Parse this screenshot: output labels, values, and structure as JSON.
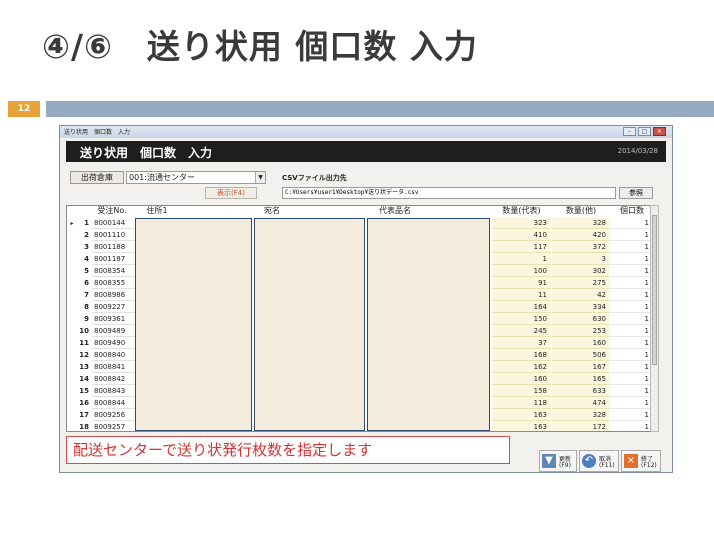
{
  "slide": {
    "title": "④/⑥　送り状用 個口数 入力",
    "page_number": "12",
    "accent_color": "#e8a23a",
    "bar_color": "#96abc2"
  },
  "window": {
    "caption": "送り状用　個口数　入力",
    "min": "–",
    "max": "□",
    "close": "×"
  },
  "app": {
    "title": "送り状用　個口数　入力",
    "date": "2014/03/28"
  },
  "form": {
    "warehouse_label": "出荷倉庫",
    "warehouse_value": "001:流通センター",
    "show_button": "表示(F4)",
    "csv_label": "CSVファイル出力先",
    "csv_path": "C:¥Users¥user1¥Desktop¥送り状データ.csv",
    "ref_button": "参照"
  },
  "grid": {
    "headers": {
      "order": "受注No.",
      "address": "住所1",
      "recipient": "宛名",
      "item": "代表品名",
      "qty_rep": "数量(代表)",
      "qty_other": "数量(他)",
      "count": "個口数"
    },
    "rows": [
      {
        "no": "1",
        "order": "8000144",
        "qty_rep": "323",
        "qty_other": "328",
        "count": "1",
        "current": "▸"
      },
      {
        "no": "2",
        "order": "8001110",
        "qty_rep": "410",
        "qty_other": "420",
        "count": "1"
      },
      {
        "no": "3",
        "order": "8001188",
        "qty_rep": "117",
        "qty_other": "372",
        "count": "1"
      },
      {
        "no": "4",
        "order": "8001187",
        "qty_rep": "1",
        "qty_other": "3",
        "count": "1"
      },
      {
        "no": "5",
        "order": "8008354",
        "qty_rep": "100",
        "qty_other": "302",
        "count": "1"
      },
      {
        "no": "6",
        "order": "8008355",
        "qty_rep": "91",
        "qty_other": "275",
        "count": "1"
      },
      {
        "no": "7",
        "order": "8008986",
        "qty_rep": "11",
        "qty_other": "42",
        "count": "1"
      },
      {
        "no": "8",
        "order": "8009227",
        "qty_rep": "164",
        "qty_other": "334",
        "count": "1"
      },
      {
        "no": "9",
        "order": "8009361",
        "qty_rep": "150",
        "qty_other": "630",
        "count": "1"
      },
      {
        "no": "10",
        "order": "8009489",
        "qty_rep": "245",
        "qty_other": "253",
        "count": "1"
      },
      {
        "no": "11",
        "order": "8009490",
        "qty_rep": "37",
        "qty_other": "160",
        "count": "1"
      },
      {
        "no": "12",
        "order": "8008840",
        "qty_rep": "168",
        "qty_other": "506",
        "count": "1"
      },
      {
        "no": "13",
        "order": "8008841",
        "qty_rep": "162",
        "qty_other": "167",
        "count": "1"
      },
      {
        "no": "14",
        "order": "8008842",
        "qty_rep": "160",
        "qty_other": "165",
        "count": "1"
      },
      {
        "no": "15",
        "order": "8008843",
        "qty_rep": "158",
        "qty_other": "633",
        "count": "1"
      },
      {
        "no": "16",
        "order": "8008844",
        "qty_rep": "118",
        "qty_other": "474",
        "count": "1"
      },
      {
        "no": "17",
        "order": "8009256",
        "qty_rep": "163",
        "qty_other": "328",
        "count": "1"
      },
      {
        "no": "18",
        "order": "8009257",
        "qty_rep": "163",
        "qty_other": "172",
        "count": "1"
      }
    ]
  },
  "message": "配送センターで送り状発行枚数を指定します",
  "footer_buttons": [
    {
      "line1": "更新",
      "line2": "(F9)",
      "icon": "save-icon",
      "glyph": "▼",
      "color": "#5f86b5"
    },
    {
      "line1": "取消",
      "line2": "(F11)",
      "icon": "undo-icon",
      "glyph": "↶",
      "color": "#4d7fc0"
    },
    {
      "line1": "終了",
      "line2": "(F12)",
      "icon": "exit-icon",
      "glyph": "×",
      "color": "#e0702e"
    }
  ]
}
